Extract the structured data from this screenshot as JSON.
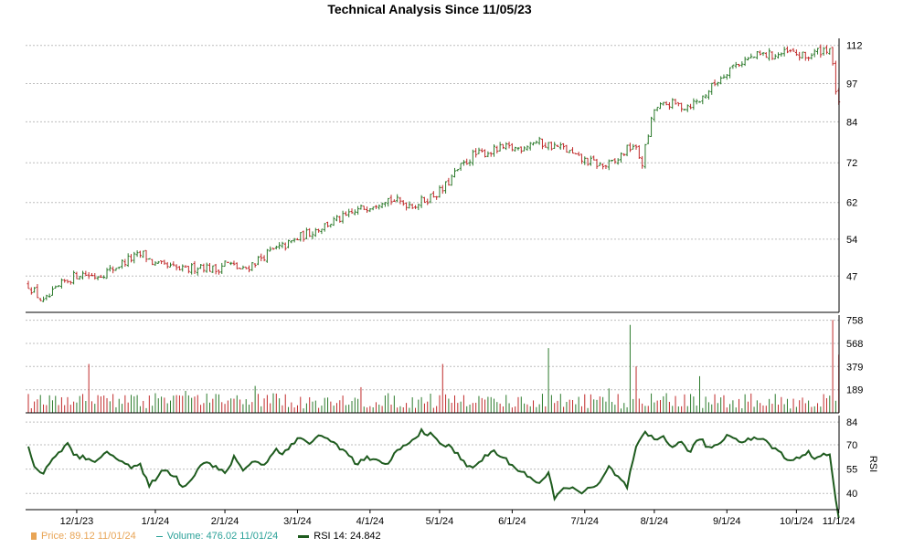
{
  "title": "Technical Analysis Since 11/05/23",
  "colors": {
    "up": "#2b7a2b",
    "down": "#c02a2a",
    "grid": "#bdbdbd",
    "price_legend": "#e8a455",
    "volume_legend": "#2aa198",
    "rsi_line": "#1e5b1e"
  },
  "legend": {
    "price": "Price: 89.12  11/01/24",
    "volume": "Volume: 476.02  11/01/24",
    "rsi": "RSI 14: 24.842"
  },
  "chart_data": [
    {
      "type": "candlestick",
      "panel": "price",
      "y_ticks": [
        47,
        54,
        62,
        72,
        84,
        97,
        112
      ],
      "y_scale": "log",
      "ylim": [
        41,
        115
      ],
      "x_tick_labels": [
        "12/1/23",
        "1/1/24",
        "2/1/24",
        "3/1/24",
        "4/1/24",
        "5/1/24",
        "6/1/24",
        "7/1/24",
        "8/1/24",
        "9/1/24",
        "10/1/24",
        "11/1/24"
      ],
      "grid": true,
      "series": [
        {
          "name": "Price",
          "close_path": [
            [
              0,
              45.5
            ],
            [
              5,
              42.5
            ],
            [
              8,
              44
            ],
            [
              12,
              46
            ],
            [
              17,
              47.5
            ],
            [
              22,
              47
            ],
            [
              27,
              48
            ],
            [
              33,
              50
            ],
            [
              38,
              51
            ],
            [
              42,
              49
            ],
            [
              47,
              48.5
            ],
            [
              52,
              48
            ],
            [
              57,
              49
            ],
            [
              62,
              48
            ],
            [
              65,
              49.5
            ],
            [
              71,
              48
            ],
            [
              76,
              50
            ],
            [
              80,
              51.5
            ],
            [
              86,
              53
            ],
            [
              90,
              54.5
            ],
            [
              95,
              56
            ],
            [
              100,
              57.5
            ],
            [
              106,
              59
            ],
            [
              110,
              60.5
            ],
            [
              115,
              62
            ],
            [
              118,
              63
            ],
            [
              123,
              62
            ],
            [
              128,
              61.5
            ],
            [
              132,
              63
            ],
            [
              137,
              65
            ],
            [
              142,
              70
            ],
            [
              147,
              74
            ],
            [
              152,
              75
            ],
            [
              157,
              76
            ],
            [
              162,
              76
            ],
            [
              167,
              78
            ],
            [
              172,
              77
            ],
            [
              177,
              76
            ],
            [
              182,
              73
            ],
            [
              187,
              72
            ],
            [
              190,
              71
            ],
            [
              194,
              72
            ],
            [
              197,
              75
            ],
            [
              200,
              77
            ],
            [
              203,
              72
            ],
            [
              205,
              80
            ],
            [
              207,
              88
            ],
            [
              212,
              90
            ],
            [
              217,
              89
            ],
            [
              222,
              91
            ],
            [
              227,
              97
            ],
            [
              232,
              103
            ],
            [
              237,
              106
            ],
            [
              242,
              108
            ],
            [
              247,
              108
            ],
            [
              252,
              109
            ],
            [
              257,
              107
            ],
            [
              262,
              110
            ],
            [
              265,
              111
            ],
            [
              267,
              95
            ],
            [
              268,
              89
            ]
          ]
        }
      ],
      "last_price": 89.12,
      "last_date": "11/01/24"
    },
    {
      "type": "bar",
      "panel": "volume",
      "y_ticks": [
        189,
        379,
        568,
        758
      ],
      "ylim": [
        0,
        800
      ],
      "spikes": [
        [
          20,
          400
        ],
        [
          52,
          180
        ],
        [
          75,
          220
        ],
        [
          110,
          210
        ],
        [
          137,
          400
        ],
        [
          172,
          530
        ],
        [
          192,
          200
        ],
        [
          199,
          720
        ],
        [
          201,
          380
        ],
        [
          222,
          300
        ],
        [
          266,
          760
        ],
        [
          268,
          476
        ]
      ],
      "base_level": 140,
      "last_volume": 476.02
    },
    {
      "type": "line",
      "panel": "rsi",
      "name": "RSI 14",
      "y_ticks": [
        40,
        55,
        70,
        84
      ],
      "ylim": [
        30,
        88
      ],
      "values_path": [
        [
          0,
          68
        ],
        [
          2,
          57
        ],
        [
          5,
          52
        ],
        [
          7,
          58
        ],
        [
          10,
          66
        ],
        [
          13,
          70
        ],
        [
          15,
          64
        ],
        [
          18,
          62
        ],
        [
          21,
          59
        ],
        [
          25,
          65
        ],
        [
          28,
          63
        ],
        [
          31,
          61
        ],
        [
          34,
          56
        ],
        [
          37,
          57
        ],
        [
          40,
          44
        ],
        [
          43,
          52
        ],
        [
          46,
          54
        ],
        [
          49,
          50
        ],
        [
          51,
          43
        ],
        [
          53,
          48
        ],
        [
          55,
          52
        ],
        [
          58,
          60
        ],
        [
          62,
          56
        ],
        [
          65,
          52
        ],
        [
          68,
          62
        ],
        [
          71,
          55
        ],
        [
          75,
          60
        ],
        [
          78,
          58
        ],
        [
          82,
          67
        ],
        [
          84,
          64
        ],
        [
          87,
          71
        ],
        [
          90,
          74
        ],
        [
          93,
          71
        ],
        [
          96,
          76
        ],
        [
          99,
          73
        ],
        [
          102,
          70
        ],
        [
          104,
          67
        ],
        [
          106,
          63
        ],
        [
          109,
          58
        ],
        [
          112,
          62
        ],
        [
          115,
          60
        ],
        [
          118,
          57
        ],
        [
          121,
          64
        ],
        [
          124,
          69
        ],
        [
          127,
          72
        ],
        [
          130,
          79
        ],
        [
          133,
          76
        ],
        [
          136,
          71
        ],
        [
          139,
          69
        ],
        [
          142,
          64
        ],
        [
          145,
          58
        ],
        [
          148,
          56
        ],
        [
          151,
          63
        ],
        [
          154,
          66
        ],
        [
          157,
          62
        ],
        [
          160,
          57
        ],
        [
          163,
          54
        ],
        [
          166,
          50
        ],
        [
          169,
          45
        ],
        [
          172,
          52
        ],
        [
          174,
          38
        ],
        [
          177,
          42
        ],
        [
          180,
          45
        ],
        [
          183,
          40
        ],
        [
          186,
          43
        ],
        [
          189,
          46
        ],
        [
          192,
          56
        ],
        [
          195,
          50
        ],
        [
          198,
          44
        ],
        [
          201,
          68
        ],
        [
          204,
          77
        ],
        [
          207,
          73
        ],
        [
          210,
          75
        ],
        [
          213,
          69
        ],
        [
          216,
          71
        ],
        [
          219,
          66
        ],
        [
          222,
          74
        ],
        [
          225,
          68
        ],
        [
          228,
          70
        ],
        [
          231,
          76
        ],
        [
          234,
          74
        ],
        [
          237,
          72
        ],
        [
          240,
          75
        ],
        [
          243,
          73
        ],
        [
          246,
          69
        ],
        [
          249,
          64
        ],
        [
          252,
          60
        ],
        [
          255,
          63
        ],
        [
          258,
          65
        ],
        [
          261,
          61
        ],
        [
          263,
          66
        ],
        [
          265,
          64
        ],
        [
          266,
          50
        ],
        [
          267,
          36
        ],
        [
          268,
          24.842
        ]
      ],
      "last_value": 24.842
    }
  ]
}
